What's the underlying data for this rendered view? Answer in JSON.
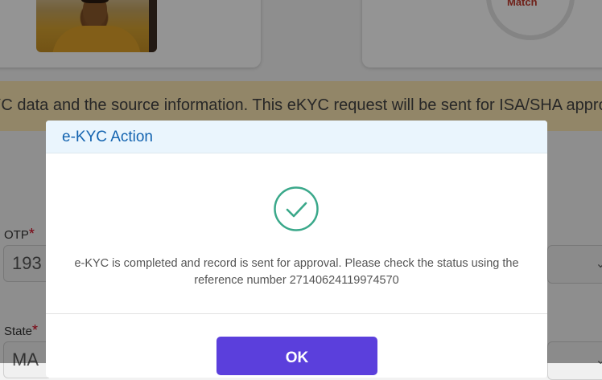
{
  "background": {
    "match_label": "Match",
    "banner_text": "YC data and the source information. This eKYC request will be sent for ISA/SHA appro",
    "otp_label": "OTP",
    "otp_value": "193",
    "state_label": "State",
    "state_value": "MA",
    "required_mark": "*"
  },
  "modal": {
    "title": "e-KYC Action",
    "message": "e-KYC is completed and record is sent for approval. Please check the status using the reference number 27140624119974570",
    "ok_label": "OK",
    "icon": "check-circle-icon"
  },
  "colors": {
    "accent": "#5b3fdc",
    "success": "#3aa88a",
    "title": "#1464b0",
    "banner": "#fbe7b4"
  }
}
